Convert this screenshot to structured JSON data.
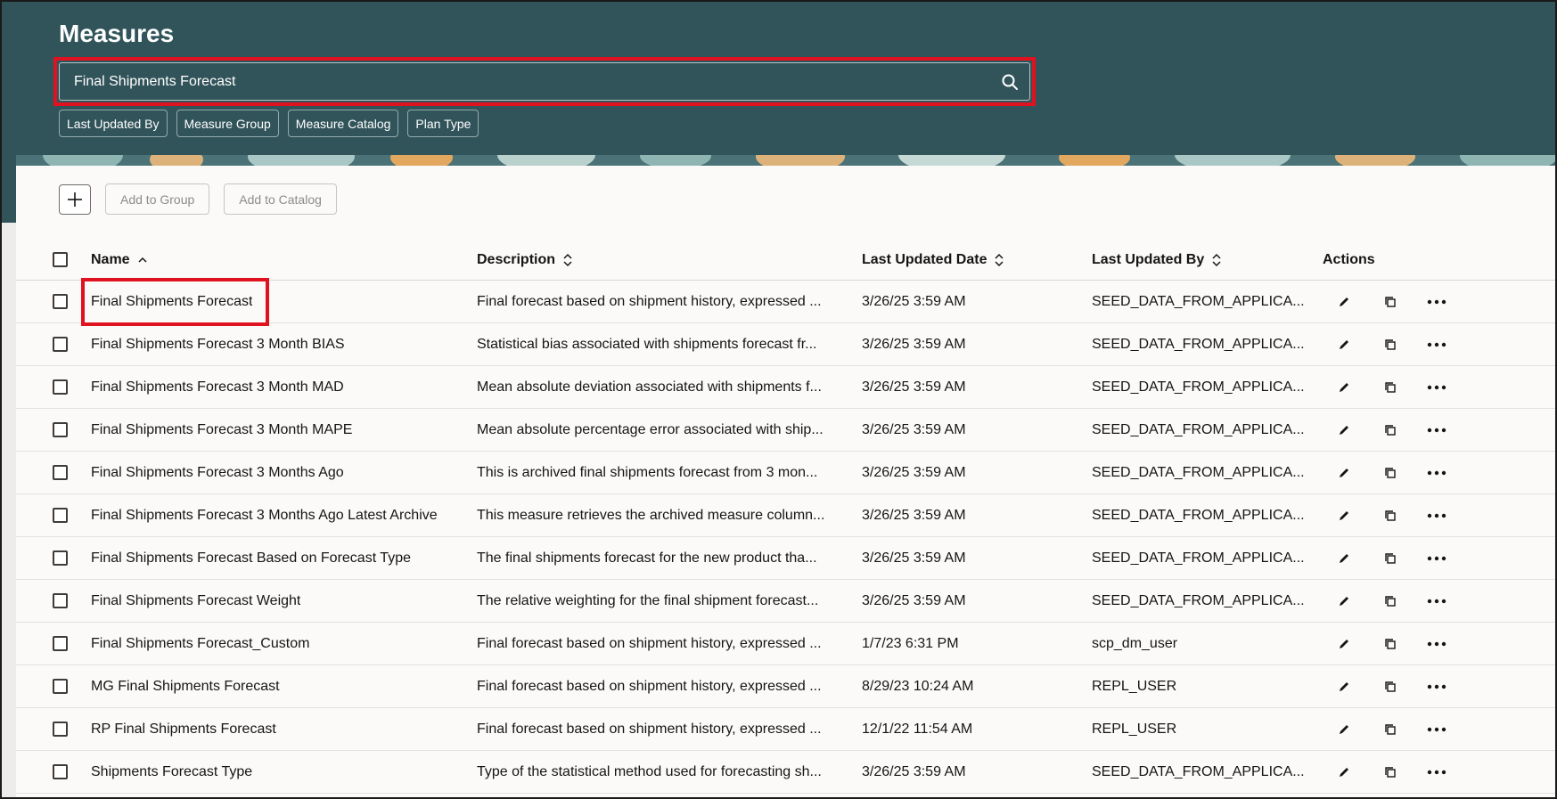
{
  "page": {
    "title": "Measures"
  },
  "search": {
    "value": "Final Shipments Forecast"
  },
  "filters": [
    "Last Updated By",
    "Measure Group",
    "Measure Catalog",
    "Plan Type"
  ],
  "toolbar": {
    "add_to_group": "Add to Group",
    "add_to_catalog": "Add to Catalog"
  },
  "table": {
    "columns": {
      "name": "Name",
      "description": "Description",
      "date": "Last Updated Date",
      "user": "Last Updated By",
      "actions": "Actions"
    },
    "rows": [
      {
        "name": "Final Shipments Forecast",
        "description": "Final forecast based on shipment history, expressed ...",
        "date": "3/26/25 3:59 AM",
        "user": "SEED_DATA_FROM_APPLICA..."
      },
      {
        "name": "Final Shipments Forecast 3 Month BIAS",
        "description": "Statistical bias associated with shipments forecast fr...",
        "date": "3/26/25 3:59 AM",
        "user": "SEED_DATA_FROM_APPLICA..."
      },
      {
        "name": "Final Shipments Forecast 3 Month MAD",
        "description": "Mean absolute deviation associated with shipments f...",
        "date": "3/26/25 3:59 AM",
        "user": "SEED_DATA_FROM_APPLICA..."
      },
      {
        "name": "Final Shipments Forecast 3 Month MAPE",
        "description": "Mean absolute percentage error associated with ship...",
        "date": "3/26/25 3:59 AM",
        "user": "SEED_DATA_FROM_APPLICA..."
      },
      {
        "name": "Final Shipments Forecast 3 Months Ago",
        "description": "This is archived final shipments forecast from 3 mon...",
        "date": "3/26/25 3:59 AM",
        "user": "SEED_DATA_FROM_APPLICA..."
      },
      {
        "name": "Final Shipments Forecast 3 Months Ago Latest Archive",
        "description": "This measure retrieves the archived measure column...",
        "date": "3/26/25 3:59 AM",
        "user": "SEED_DATA_FROM_APPLICA..."
      },
      {
        "name": "Final Shipments Forecast Based on Forecast Type",
        "description": "The final shipments forecast for the new product tha...",
        "date": "3/26/25 3:59 AM",
        "user": "SEED_DATA_FROM_APPLICA..."
      },
      {
        "name": "Final Shipments Forecast Weight",
        "description": "The relative weighting for the final shipment forecast...",
        "date": "3/26/25 3:59 AM",
        "user": "SEED_DATA_FROM_APPLICA..."
      },
      {
        "name": "Final Shipments Forecast_Custom",
        "description": "Final forecast based on shipment history, expressed ...",
        "date": "1/7/23 6:31 PM",
        "user": "scp_dm_user"
      },
      {
        "name": "MG Final Shipments Forecast",
        "description": "Final forecast based on shipment history, expressed ...",
        "date": "8/29/23 10:24 AM",
        "user": "REPL_USER"
      },
      {
        "name": "RP Final Shipments Forecast",
        "description": "Final forecast based on shipment history, expressed ...",
        "date": "12/1/22 11:54 AM",
        "user": "REPL_USER"
      },
      {
        "name": "Shipments Forecast Type",
        "description": "Type of the statistical method used for forecasting sh...",
        "date": "3/26/25 3:59 AM",
        "user": "SEED_DATA_FROM_APPLICA..."
      }
    ]
  },
  "colors": {
    "header_bg": "#31545a",
    "highlight": "#e0121f",
    "content_bg": "#fbfaf9"
  }
}
